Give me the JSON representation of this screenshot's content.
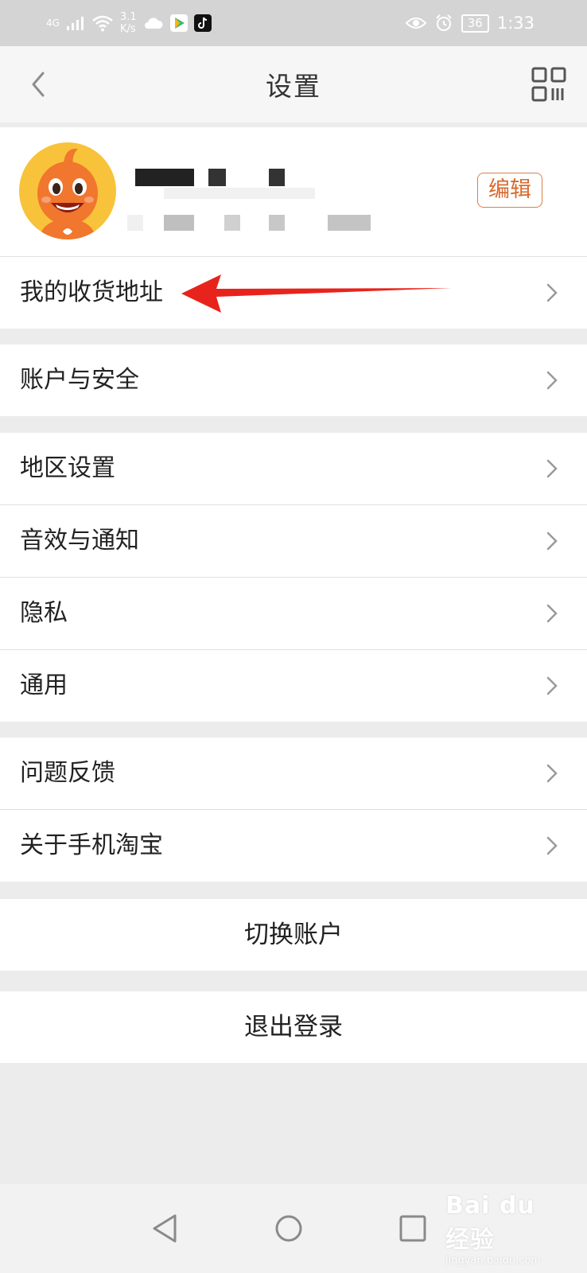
{
  "status_bar": {
    "network": "4G",
    "speed_value": "3.1",
    "speed_unit": "K/s",
    "battery": "36",
    "time": "1:33"
  },
  "nav": {
    "title": "设置"
  },
  "profile": {
    "edit_label": "编辑"
  },
  "groups": [
    {
      "items": [
        {
          "label": "我的收货地址"
        }
      ]
    },
    {
      "items": [
        {
          "label": "账户与安全"
        }
      ]
    },
    {
      "items": [
        {
          "label": "地区设置"
        },
        {
          "label": "音效与通知"
        },
        {
          "label": "隐私"
        },
        {
          "label": "通用"
        }
      ]
    },
    {
      "items": [
        {
          "label": "问题反馈"
        },
        {
          "label": "关于手机淘宝"
        }
      ]
    }
  ],
  "actions": {
    "switch_account": "切换账户",
    "logout": "退出登录"
  },
  "watermark": {
    "main": "Bai du 经验",
    "sub": "jingyan.baidu.com"
  },
  "colors": {
    "accent": "#d76a2e",
    "arrow": "#e8231b",
    "avatar_bg": "#f8c33a"
  },
  "icons": [
    "back-icon",
    "qr-code-icon",
    "chevron-right-icon",
    "signal-icon",
    "wifi-icon",
    "cloud-icon",
    "eye-icon",
    "alarm-icon",
    "back-triangle-icon",
    "home-circle-icon",
    "recents-square-icon"
  ]
}
